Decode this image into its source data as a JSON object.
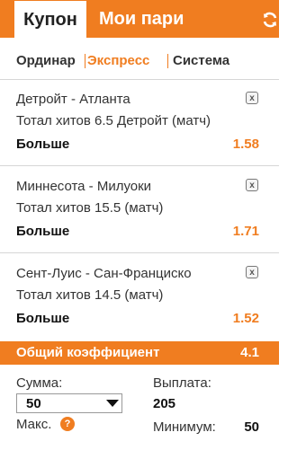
{
  "header": {
    "tab_coupon": "Купон",
    "tab_my_bets": "Мои пари"
  },
  "modes": {
    "single": "Ординар",
    "express": "Экспресс",
    "system": "Система",
    "active": "express"
  },
  "bets": [
    {
      "match": "Детройт - Атланта",
      "market": "Тотал хитов 6.5 Детройт (матч)",
      "choice": "Больше",
      "odds": "1.58"
    },
    {
      "match": "Миннесота - Милуоки",
      "market": "Тотал хитов 15.5 (матч)",
      "choice": "Больше",
      "odds": "1.71"
    },
    {
      "match": "Сент-Луис - Сан-Франциско",
      "market": "Тотал хитов 14.5 (матч)",
      "choice": "Больше",
      "odds": "1.52"
    }
  ],
  "total": {
    "label": "Общий коэффициент",
    "value": "4.1"
  },
  "stake": {
    "label": "Сумма:",
    "selected": "50",
    "max_label": "Макс.",
    "help_glyph": "?"
  },
  "payout": {
    "label": "Выплата:",
    "value": "205",
    "min_label": "Минимум:",
    "min_value": "50"
  },
  "icons": {
    "close_glyph": "x"
  },
  "colors": {
    "accent": "#f07d20",
    "text": "#222222",
    "divider": "#d6d6d6"
  }
}
